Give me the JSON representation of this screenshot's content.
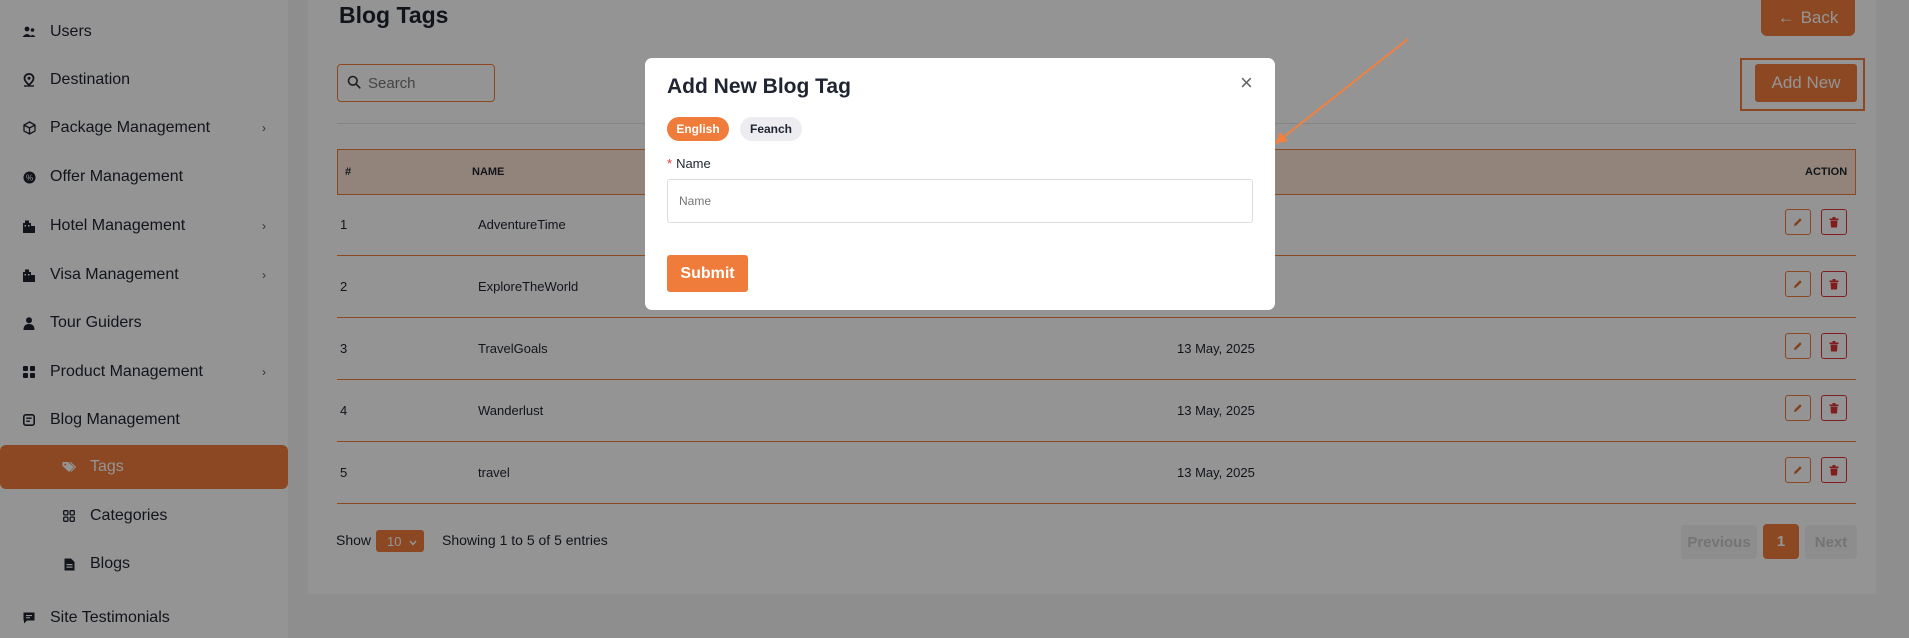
{
  "sidebar": {
    "items": [
      {
        "label": "Users",
        "icon": "users-icon",
        "has_children": false
      },
      {
        "label": "Destination",
        "icon": "map-pin-icon",
        "has_children": false
      },
      {
        "label": "Package Management",
        "icon": "cube-icon",
        "has_children": true
      },
      {
        "label": "Offer Management",
        "icon": "badge-icon",
        "has_children": false
      },
      {
        "label": "Hotel Management",
        "icon": "hotel-icon",
        "has_children": true
      },
      {
        "label": "Visa Management",
        "icon": "visa-icon",
        "has_children": true
      },
      {
        "label": "Tour Guiders",
        "icon": "person-icon",
        "has_children": false
      },
      {
        "label": "Product Management",
        "icon": "grid-icon",
        "has_children": true
      },
      {
        "label": "Blog Management",
        "icon": "blog-icon",
        "has_children": false
      }
    ],
    "sub_items": [
      {
        "label": "Tags",
        "icon": "tag-icon",
        "active": true
      },
      {
        "label": "Categories",
        "icon": "categories-icon",
        "active": false
      },
      {
        "label": "Blogs",
        "icon": "document-icon",
        "active": false
      }
    ],
    "bottom_item": {
      "label": "Site Testimonials",
      "icon": "comment-icon"
    }
  },
  "header": {
    "title": "Blog Tags",
    "back_label": "Back",
    "back_arrow": "←"
  },
  "toolbar": {
    "search_placeholder": "Search",
    "add_new_label": "Add New"
  },
  "table": {
    "columns": [
      "#",
      "NAME",
      "ACTION"
    ],
    "rows": [
      {
        "num": "1",
        "name": "AdventureTime",
        "date": ""
      },
      {
        "num": "2",
        "name": "ExploreTheWorld",
        "date": ""
      },
      {
        "num": "3",
        "name": "TravelGoals",
        "date": "13 May, 2025"
      },
      {
        "num": "4",
        "name": "Wanderlust",
        "date": "13 May, 2025"
      },
      {
        "num": "5",
        "name": "travel",
        "date": "13 May, 2025"
      }
    ]
  },
  "footer": {
    "show_label": "Show",
    "per_page": "10",
    "info": "Showing 1 to 5 of 5 entries",
    "previous_label": "Previous",
    "current_page": "1",
    "next_label": "Next"
  },
  "modal": {
    "title": "Add New Blog Tag",
    "close_symbol": "×",
    "languages": [
      "English",
      "Feanch"
    ],
    "active_language": "English",
    "field_label": "Name",
    "required_mark": "*",
    "field_placeholder": "Name",
    "submit_label": "Submit"
  },
  "colors": {
    "accent": "#f07c3c",
    "overlay": "rgba(0,0,0,0.42)",
    "danger": "#d33333"
  }
}
